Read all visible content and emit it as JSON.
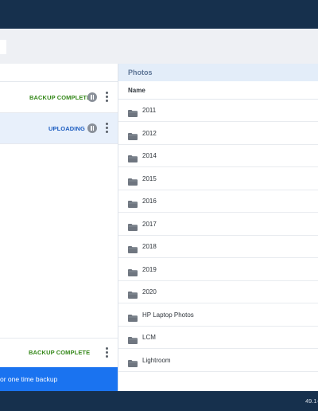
{
  "left_pane": {
    "jobs": [
      {
        "status": "BACKUP COMPLETE"
      },
      {
        "status": "UPLOADING"
      },
      {
        "status": "BACKUP COMPLETE"
      }
    ],
    "cta_label": "or one time backup"
  },
  "right_pane": {
    "title": "Photos",
    "column_name": "Name",
    "folders": [
      "2011",
      "2012",
      "2014",
      "2015",
      "2016",
      "2017",
      "2018",
      "2019",
      "2020",
      "HP Laptop Photos",
      "LCM",
      "Lightroom"
    ]
  },
  "footer": {
    "version": "49.1-"
  },
  "colors": {
    "header_bg": "#16304d",
    "complete_green": "#35881a",
    "uploading_blue": "#1b5cc0",
    "cta_blue": "#1a73f0",
    "photos_head_bg": "#e3edf9"
  },
  "icons": [
    "pause-icon",
    "kebab-menu-icon",
    "folder-icon"
  ]
}
